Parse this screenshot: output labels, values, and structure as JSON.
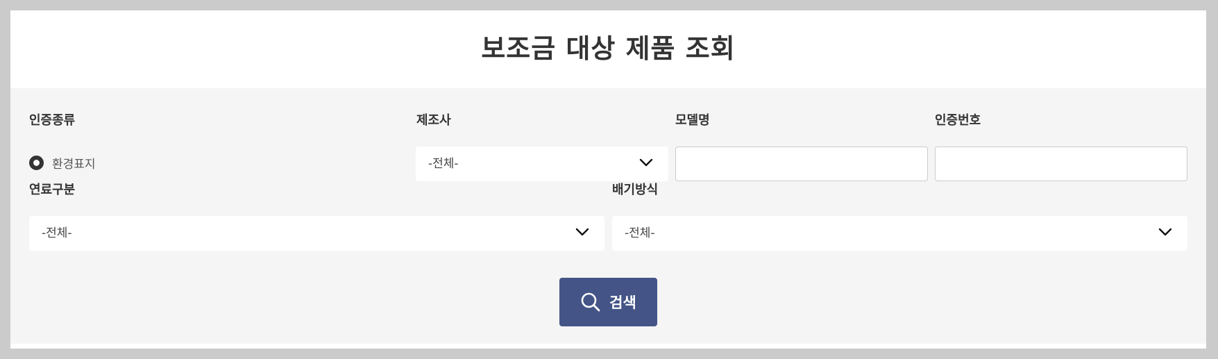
{
  "page_title": "보조금 대상 제품 조회",
  "filters": {
    "cert_type": {
      "label": "인증종류",
      "options": [
        "환경표지"
      ],
      "selected": "환경표지"
    },
    "manufacturer": {
      "label": "제조사",
      "value": "-전체-"
    },
    "model_name": {
      "label": "모델명",
      "value": "",
      "placeholder": ""
    },
    "cert_number": {
      "label": "인증번호",
      "value": "",
      "placeholder": ""
    },
    "fuel_type": {
      "label": "연료구분",
      "value": "-전체-"
    },
    "exhaust_type": {
      "label": "배기방식",
      "value": "-전체-"
    }
  },
  "search_button": {
    "label": "검색",
    "icon": "search-icon",
    "color": "#445487"
  }
}
